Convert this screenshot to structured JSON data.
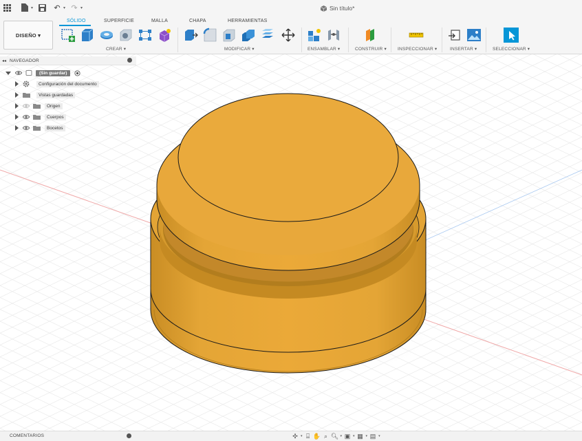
{
  "app": {
    "document_title": "Sin título*"
  },
  "workspace": {
    "label": "DISEÑO ▾"
  },
  "tabs": [
    {
      "label": "SÓLIDO",
      "active": true
    },
    {
      "label": "SUPERFICIE",
      "active": false
    },
    {
      "label": "MALLA",
      "active": false
    },
    {
      "label": "CHAPA",
      "active": false
    },
    {
      "label": "HERRAMIENTAS",
      "active": false
    }
  ],
  "tool_groups": [
    {
      "label": "CREAR ▾"
    },
    {
      "label": "MODIFICAR ▾"
    },
    {
      "label": "ENSAMBLAR ▾"
    },
    {
      "label": "CONSTRUIR ▾"
    },
    {
      "label": "INSPECCIONAR ▾"
    },
    {
      "label": "INSERTAR ▾"
    },
    {
      "label": "SELECCIONAR ▾"
    }
  ],
  "navigator": {
    "title": "NAVEGADOR",
    "root": "(Sin guardar)",
    "items": [
      {
        "label": "Configuración del documento",
        "icon": "gear-icon"
      },
      {
        "label": "Vistas guardadas",
        "icon": "folder-icon"
      },
      {
        "label": "Origen",
        "icon": "folder-icon"
      },
      {
        "label": "Cuerpos",
        "icon": "folder-icon"
      },
      {
        "label": "Bocetos",
        "icon": "folder-icon"
      }
    ]
  },
  "comments": {
    "label": "COMENTARIOS"
  },
  "colors": {
    "accent": "#0696d7",
    "body_fill": "#e9a93a",
    "body_shade": "#d99628",
    "grid": "#e4e4e4"
  }
}
